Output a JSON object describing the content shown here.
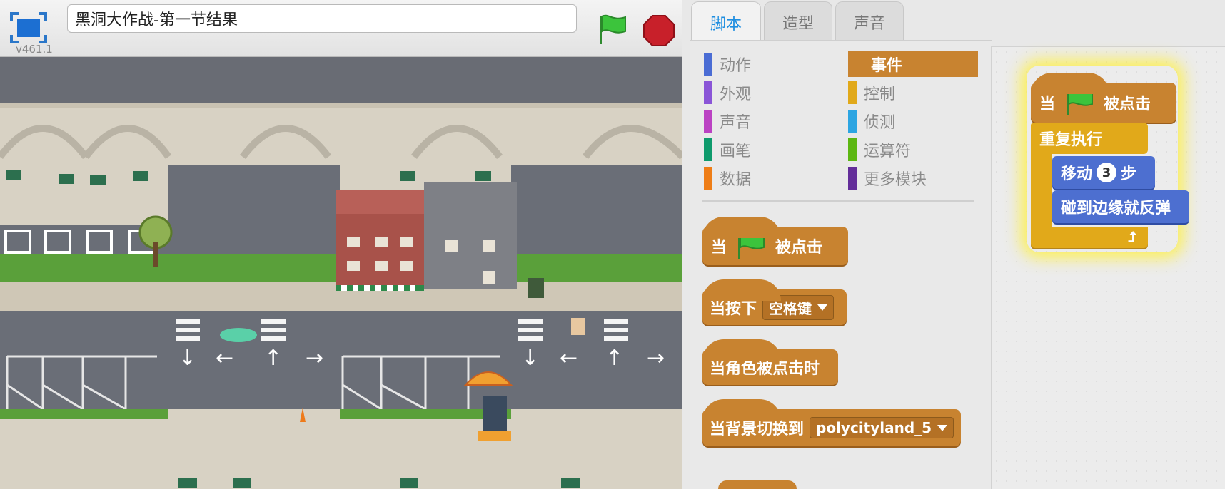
{
  "app": {
    "version": "v461.1",
    "project_title": "黑洞大作战-第一节结果"
  },
  "tabs": [
    {
      "label": "脚本",
      "active": true
    },
    {
      "label": "造型",
      "active": false
    },
    {
      "label": "声音",
      "active": false
    }
  ],
  "categories_left": [
    {
      "label": "动作",
      "color": "#4a6cd4"
    },
    {
      "label": "外观",
      "color": "#8a55d7"
    },
    {
      "label": "声音",
      "color": "#bb42c3"
    },
    {
      "label": "画笔",
      "color": "#0e9a6c"
    },
    {
      "label": "数据",
      "color": "#ee7d16"
    }
  ],
  "categories_right": [
    {
      "label": "事件",
      "color": "#c88330",
      "active": true
    },
    {
      "label": "控制",
      "color": "#e1a91a"
    },
    {
      "label": "侦测",
      "color": "#2ca5e2"
    },
    {
      "label": "运算符",
      "color": "#5cb712"
    },
    {
      "label": "更多模块",
      "color": "#632d99"
    }
  ],
  "palette_blocks": {
    "when_flag": {
      "prefix": "当",
      "suffix": "被点击"
    },
    "when_key": {
      "prefix": "当按下",
      "dropdown": "空格键"
    },
    "when_sprite_clicked": {
      "label": "当角色被点击时"
    },
    "when_backdrop": {
      "prefix": "当背景切换到",
      "dropdown": "polycityland_5"
    }
  },
  "script": {
    "hat": {
      "prefix": "当",
      "suffix": "被点击"
    },
    "forever": "重复执行",
    "move": {
      "prefix": "移动",
      "value": "3",
      "suffix": "步"
    },
    "bounce": "碰到边缘就反弹"
  },
  "colors": {
    "events": "#c88330",
    "control": "#e1a91a",
    "motion": "#4d6fd0",
    "tab_active_text": "#1e8ee0",
    "flag_green": "#3cc43c",
    "stop_red": "#c8202a"
  }
}
